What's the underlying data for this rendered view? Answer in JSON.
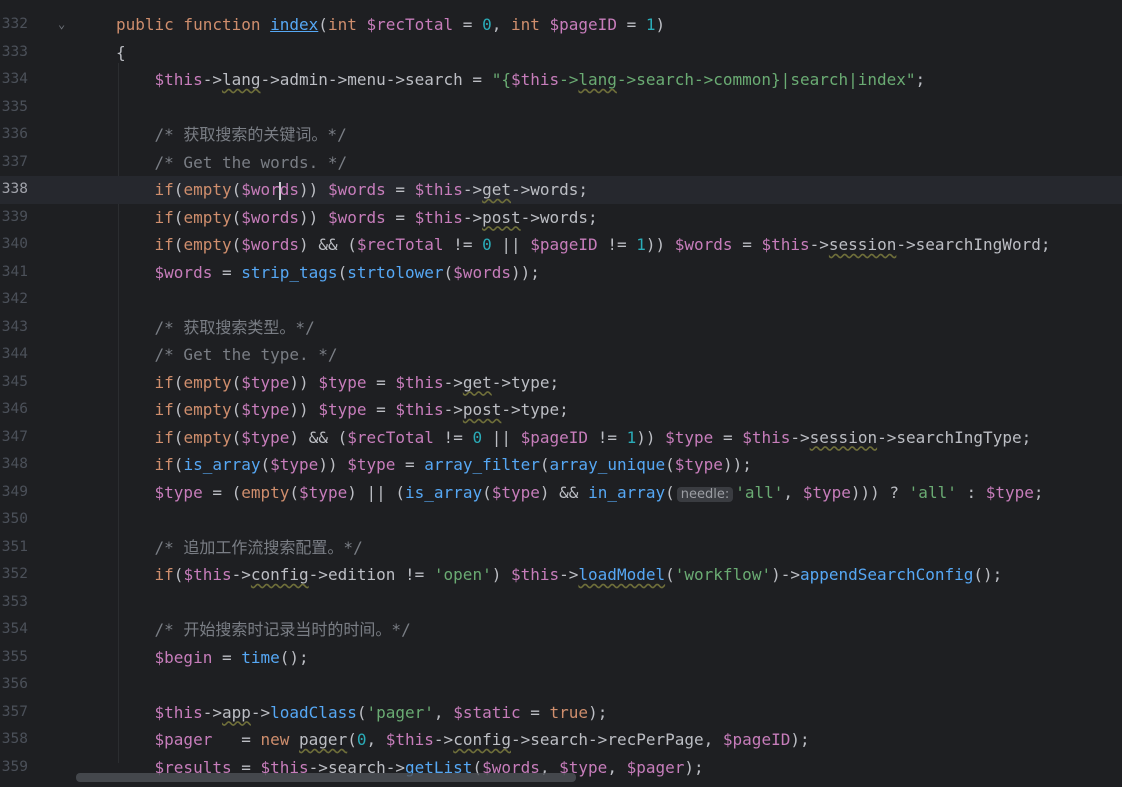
{
  "editor": {
    "lines": [
      {
        "num": "332",
        "tokens": [
          [
            "kw",
            "public function "
          ],
          [
            "fnu",
            "index"
          ],
          [
            "p",
            "("
          ],
          [
            "kw",
            "int "
          ],
          [
            "v",
            "$recTotal"
          ],
          [
            "p",
            " = "
          ],
          [
            "n",
            "0"
          ],
          [
            "p",
            ", "
          ],
          [
            "kw",
            "int "
          ],
          [
            "v",
            "$pageID"
          ],
          [
            "p",
            " = "
          ],
          [
            "n",
            "1"
          ],
          [
            "p",
            ")"
          ]
        ]
      },
      {
        "num": "333",
        "tokens": [
          [
            "p",
            "{"
          ]
        ]
      },
      {
        "num": "334",
        "tokens": [
          [
            "v",
            "    $this"
          ],
          [
            "p",
            "->"
          ],
          [
            "u",
            "lang"
          ],
          [
            "p",
            "->admin->menu->search = "
          ],
          [
            "s",
            "\"{"
          ],
          [
            "v",
            "$this"
          ],
          [
            "s",
            "->"
          ],
          [
            "su",
            "lang"
          ],
          [
            "s",
            "->search->common}|search|index\""
          ],
          [
            "p",
            ";"
          ]
        ]
      },
      {
        "num": "335",
        "tokens": []
      },
      {
        "num": "336",
        "tokens": [
          [
            "c",
            "    /* 获取搜索的关键词。*/"
          ]
        ]
      },
      {
        "num": "337",
        "tokens": [
          [
            "c",
            "    /* Get the words. */"
          ]
        ]
      },
      {
        "num": "338",
        "tokens": [
          [
            "kw",
            "    if"
          ],
          [
            "p",
            "("
          ],
          [
            "kw",
            "empty"
          ],
          [
            "p",
            "("
          ],
          [
            "v",
            "$wor"
          ],
          [
            "caret",
            ""
          ],
          [
            "v",
            "ds"
          ],
          [
            "p",
            ")) "
          ],
          [
            "v",
            "$words"
          ],
          [
            "p",
            " = "
          ],
          [
            "v",
            "$this"
          ],
          [
            "p",
            "->"
          ],
          [
            "u",
            "get"
          ],
          [
            "p",
            "->words;"
          ]
        ]
      },
      {
        "num": "339",
        "tokens": [
          [
            "kw",
            "    if"
          ],
          [
            "p",
            "("
          ],
          [
            "kw",
            "empty"
          ],
          [
            "p",
            "("
          ],
          [
            "v",
            "$words"
          ],
          [
            "p",
            ")) "
          ],
          [
            "v",
            "$words"
          ],
          [
            "p",
            " = "
          ],
          [
            "v",
            "$this"
          ],
          [
            "p",
            "->"
          ],
          [
            "u",
            "post"
          ],
          [
            "p",
            "->words;"
          ]
        ]
      },
      {
        "num": "340",
        "tokens": [
          [
            "kw",
            "    if"
          ],
          [
            "p",
            "("
          ],
          [
            "kw",
            "empty"
          ],
          [
            "p",
            "("
          ],
          [
            "v",
            "$words"
          ],
          [
            "p",
            ") && ("
          ],
          [
            "v",
            "$recTotal"
          ],
          [
            "p",
            " != "
          ],
          [
            "n",
            "0"
          ],
          [
            "p",
            " || "
          ],
          [
            "v",
            "$pageID"
          ],
          [
            "p",
            " != "
          ],
          [
            "n",
            "1"
          ],
          [
            "p",
            ")) "
          ],
          [
            "v",
            "$words"
          ],
          [
            "p",
            " = "
          ],
          [
            "v",
            "$this"
          ],
          [
            "p",
            "->"
          ],
          [
            "u",
            "session"
          ],
          [
            "p",
            "->searchIngWord;"
          ]
        ]
      },
      {
        "num": "341",
        "tokens": [
          [
            "v",
            "    $words"
          ],
          [
            "p",
            " = "
          ],
          [
            "fn",
            "strip_tags"
          ],
          [
            "p",
            "("
          ],
          [
            "fn",
            "strtolower"
          ],
          [
            "p",
            "("
          ],
          [
            "v",
            "$words"
          ],
          [
            "p",
            "));"
          ]
        ]
      },
      {
        "num": "342",
        "tokens": []
      },
      {
        "num": "343",
        "tokens": [
          [
            "c",
            "    /* 获取搜索类型。*/"
          ]
        ]
      },
      {
        "num": "344",
        "tokens": [
          [
            "c",
            "    /* Get the type. */"
          ]
        ]
      },
      {
        "num": "345",
        "tokens": [
          [
            "kw",
            "    if"
          ],
          [
            "p",
            "("
          ],
          [
            "kw",
            "empty"
          ],
          [
            "p",
            "("
          ],
          [
            "v",
            "$type"
          ],
          [
            "p",
            ")) "
          ],
          [
            "v",
            "$type"
          ],
          [
            "p",
            " = "
          ],
          [
            "v",
            "$this"
          ],
          [
            "p",
            "->"
          ],
          [
            "u",
            "get"
          ],
          [
            "p",
            "->type;"
          ]
        ]
      },
      {
        "num": "346",
        "tokens": [
          [
            "kw",
            "    if"
          ],
          [
            "p",
            "("
          ],
          [
            "kw",
            "empty"
          ],
          [
            "p",
            "("
          ],
          [
            "v",
            "$type"
          ],
          [
            "p",
            ")) "
          ],
          [
            "v",
            "$type"
          ],
          [
            "p",
            " = "
          ],
          [
            "v",
            "$this"
          ],
          [
            "p",
            "->"
          ],
          [
            "u",
            "post"
          ],
          [
            "p",
            "->type;"
          ]
        ]
      },
      {
        "num": "347",
        "tokens": [
          [
            "kw",
            "    if"
          ],
          [
            "p",
            "("
          ],
          [
            "kw",
            "empty"
          ],
          [
            "p",
            "("
          ],
          [
            "v",
            "$type"
          ],
          [
            "p",
            ") && ("
          ],
          [
            "v",
            "$recTotal"
          ],
          [
            "p",
            " != "
          ],
          [
            "n",
            "0"
          ],
          [
            "p",
            " || "
          ],
          [
            "v",
            "$pageID"
          ],
          [
            "p",
            " != "
          ],
          [
            "n",
            "1"
          ],
          [
            "p",
            ")) "
          ],
          [
            "v",
            "$type"
          ],
          [
            "p",
            " = "
          ],
          [
            "v",
            "$this"
          ],
          [
            "p",
            "->"
          ],
          [
            "u",
            "session"
          ],
          [
            "p",
            "->searchIngType;"
          ]
        ]
      },
      {
        "num": "348",
        "tokens": [
          [
            "kw",
            "    if"
          ],
          [
            "p",
            "("
          ],
          [
            "fn",
            "is_array"
          ],
          [
            "p",
            "("
          ],
          [
            "v",
            "$type"
          ],
          [
            "p",
            ")) "
          ],
          [
            "v",
            "$type"
          ],
          [
            "p",
            " = "
          ],
          [
            "fn",
            "array_filter"
          ],
          [
            "p",
            "("
          ],
          [
            "fn",
            "array_unique"
          ],
          [
            "p",
            "("
          ],
          [
            "v",
            "$type"
          ],
          [
            "p",
            "));"
          ]
        ]
      },
      {
        "num": "349",
        "tokens": [
          [
            "v",
            "    $type"
          ],
          [
            "p",
            " = ("
          ],
          [
            "kw",
            "empty"
          ],
          [
            "p",
            "("
          ],
          [
            "v",
            "$type"
          ],
          [
            "p",
            ") || ("
          ],
          [
            "fn",
            "is_array"
          ],
          [
            "p",
            "("
          ],
          [
            "v",
            "$type"
          ],
          [
            "p",
            ") && "
          ],
          [
            "fn",
            "in_array"
          ],
          [
            "p",
            "("
          ],
          [
            "hint",
            "needle:"
          ],
          [
            "s",
            "'all'"
          ],
          [
            "p",
            ", "
          ],
          [
            "v",
            "$type"
          ],
          [
            "p",
            ")))"
          ],
          [
            "p",
            " ? "
          ],
          [
            "s",
            "'all'"
          ],
          [
            "p",
            " : "
          ],
          [
            "v",
            "$type"
          ],
          [
            "p",
            ";"
          ]
        ]
      },
      {
        "num": "350",
        "tokens": []
      },
      {
        "num": "351",
        "tokens": [
          [
            "c",
            "    /* 追加工作流搜索配置。*/"
          ]
        ]
      },
      {
        "num": "352",
        "tokens": [
          [
            "kw",
            "    if"
          ],
          [
            "p",
            "("
          ],
          [
            "v",
            "$this"
          ],
          [
            "p",
            "->"
          ],
          [
            "u",
            "config"
          ],
          [
            "p",
            "->edition != "
          ],
          [
            "s",
            "'open'"
          ],
          [
            "p",
            ") "
          ],
          [
            "v",
            "$this"
          ],
          [
            "p",
            "->"
          ],
          [
            "fnuw",
            "loadModel"
          ],
          [
            "p",
            "("
          ],
          [
            "s",
            "'workflow'"
          ],
          [
            "p",
            ")->"
          ],
          [
            "fn",
            "appendSearchConfig"
          ],
          [
            "p",
            "();"
          ]
        ]
      },
      {
        "num": "353",
        "tokens": []
      },
      {
        "num": "354",
        "tokens": [
          [
            "c",
            "    /* 开始搜索时记录当时的时间。*/"
          ]
        ]
      },
      {
        "num": "355",
        "tokens": [
          [
            "v",
            "    $begin"
          ],
          [
            "p",
            " = "
          ],
          [
            "fn",
            "time"
          ],
          [
            "p",
            "();"
          ]
        ]
      },
      {
        "num": "356",
        "tokens": []
      },
      {
        "num": "357",
        "tokens": [
          [
            "v",
            "    $this"
          ],
          [
            "p",
            "->"
          ],
          [
            "u",
            "app"
          ],
          [
            "p",
            "->"
          ],
          [
            "fn",
            "loadClass"
          ],
          [
            "p",
            "("
          ],
          [
            "s",
            "'pager'"
          ],
          [
            "p",
            ", "
          ],
          [
            "v",
            "$static"
          ],
          [
            "p",
            " = "
          ],
          [
            "kw",
            "true"
          ],
          [
            "p",
            ");"
          ]
        ]
      },
      {
        "num": "358",
        "tokens": [
          [
            "v",
            "    $pager"
          ],
          [
            "p",
            "   = "
          ],
          [
            "kw",
            "new "
          ],
          [
            "u",
            "pager"
          ],
          [
            "p",
            "("
          ],
          [
            "n",
            "0"
          ],
          [
            "p",
            ", "
          ],
          [
            "v",
            "$this"
          ],
          [
            "p",
            "->"
          ],
          [
            "u",
            "config"
          ],
          [
            "p",
            "->search->recPerPage, "
          ],
          [
            "v",
            "$pageID"
          ],
          [
            "p",
            ");"
          ]
        ]
      },
      {
        "num": "359",
        "tokens": [
          [
            "v",
            "    $results"
          ],
          [
            "p",
            " = "
          ],
          [
            "v",
            "$this"
          ],
          [
            "p",
            "->search->"
          ],
          [
            "fn",
            "getList"
          ],
          [
            "p",
            "("
          ],
          [
            "v",
            "$words"
          ],
          [
            "p",
            ", "
          ],
          [
            "v",
            "$type"
          ],
          [
            "p",
            ", "
          ],
          [
            "v",
            "$pager"
          ],
          [
            "p",
            ");"
          ]
        ]
      }
    ]
  }
}
